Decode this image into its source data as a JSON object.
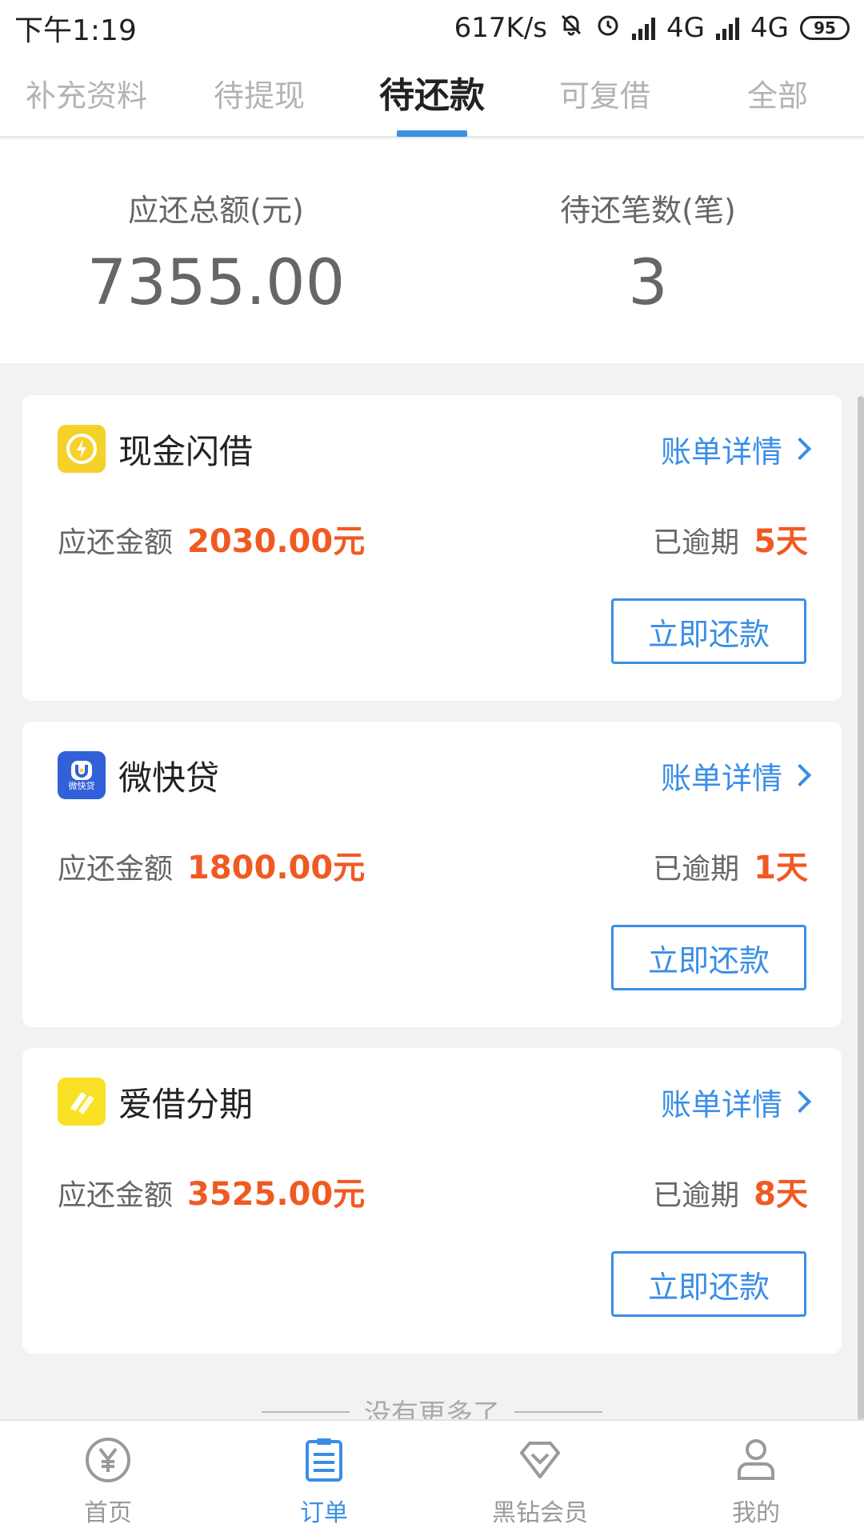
{
  "status_bar": {
    "time": "下午1:19",
    "net_speed": "617K/s",
    "network1": "4G",
    "network2": "4G",
    "battery": "95"
  },
  "tabs": [
    {
      "label": "补充资料",
      "active": false
    },
    {
      "label": "待提现",
      "active": false
    },
    {
      "label": "待还款",
      "active": true
    },
    {
      "label": "可复借",
      "active": false
    },
    {
      "label": "全部",
      "active": false
    }
  ],
  "summary": {
    "total_label": "应还总额(元)",
    "total_value": "7355.00",
    "count_label": "待还笔数(笔)",
    "count_value": "3"
  },
  "loans": [
    {
      "app_name": "现金闪借",
      "icon": "lightning-clock-icon",
      "detail_label": "账单详情",
      "amount_label": "应还金额",
      "amount": "2030.00元",
      "overdue_label": "已逾期",
      "overdue_days": "5天",
      "button": "立即还款"
    },
    {
      "app_name": "微快贷",
      "icon": "wkd-logo-icon",
      "detail_label": "账单详情",
      "amount_label": "应还金额",
      "amount": "1800.00元",
      "overdue_label": "已逾期",
      "overdue_days": "1天",
      "button": "立即还款"
    },
    {
      "app_name": "爱借分期",
      "icon": "stripes-logo-icon",
      "detail_label": "账单详情",
      "amount_label": "应还金额",
      "amount": "3525.00元",
      "overdue_label": "已逾期",
      "overdue_days": "8天",
      "button": "立即还款"
    }
  ],
  "logo_text": {
    "wkd": "微快贷"
  },
  "footer_text": "没有更多了",
  "bottom_nav": [
    {
      "label": "首页",
      "icon": "yen-coin-icon",
      "active": false
    },
    {
      "label": "订单",
      "icon": "order-list-icon",
      "active": true
    },
    {
      "label": "黑钻会员",
      "icon": "diamond-icon",
      "active": false
    },
    {
      "label": "我的",
      "icon": "person-icon",
      "active": false
    }
  ],
  "colors": {
    "accent": "#3a8ee6",
    "warning": "#f05a22",
    "icon_yellow": "#f5d12b"
  }
}
